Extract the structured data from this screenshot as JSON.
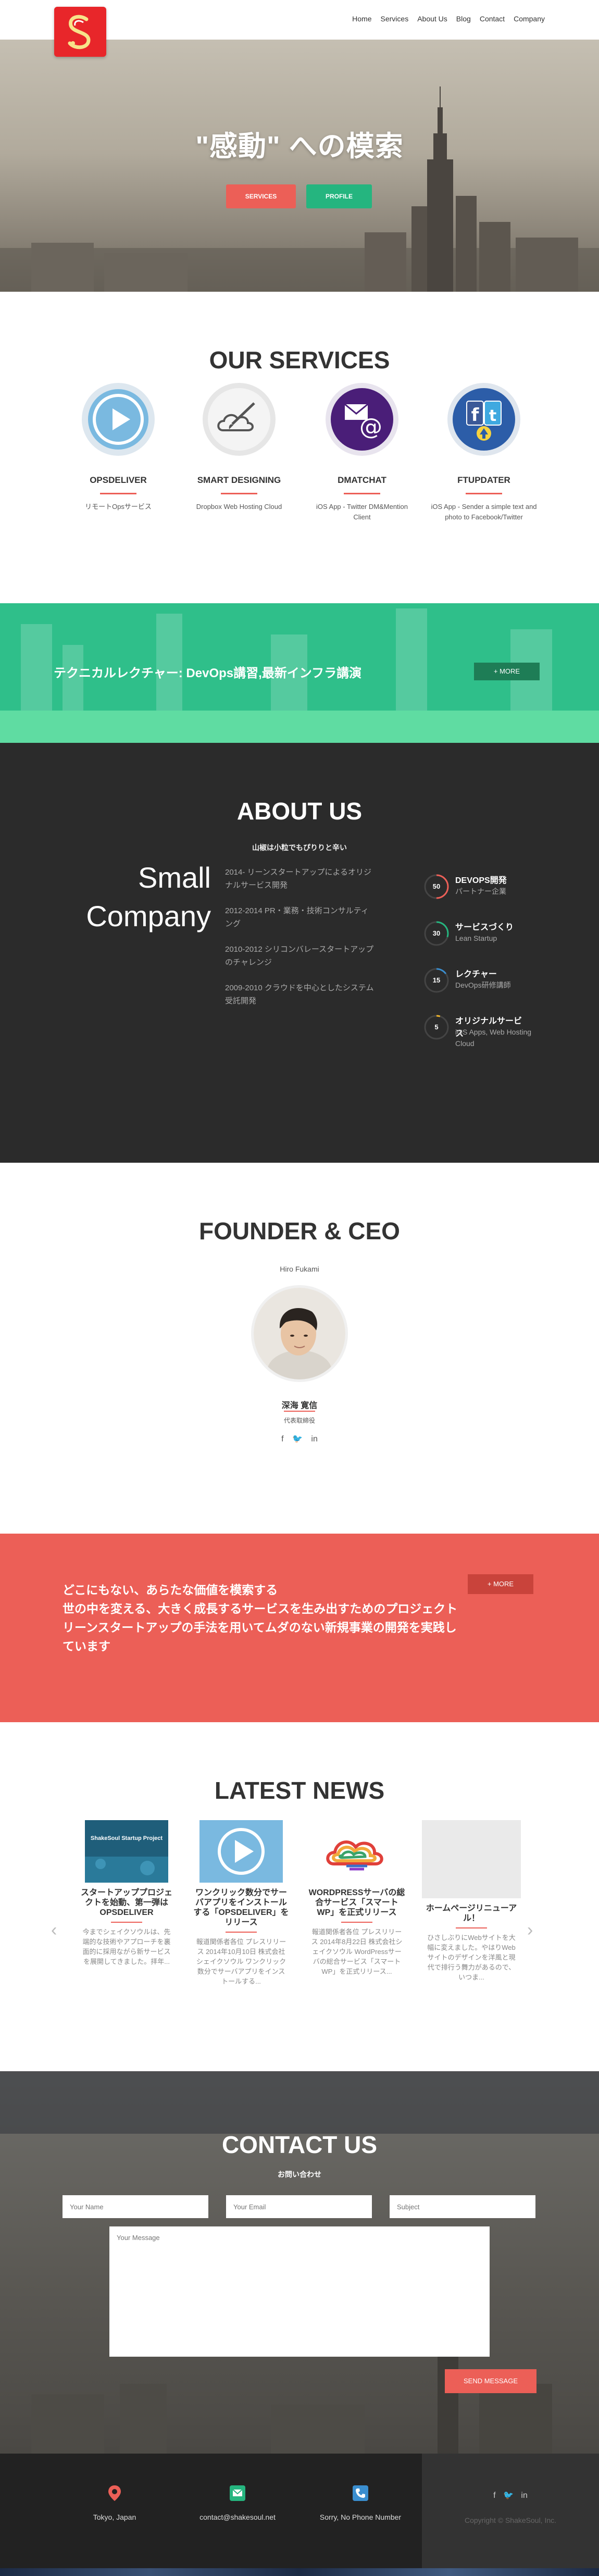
{
  "nav": {
    "menu": [
      "Home",
      "Services",
      "About Us",
      "Blog",
      "Contact",
      "Company"
    ]
  },
  "hero": {
    "title": "\"感動\" への模索",
    "services_btn": "SERVICES",
    "profile_btn": "PROFILE"
  },
  "services": {
    "title": "OUR SERVICES",
    "items": [
      {
        "name": "OPSDELIVER",
        "desc": "リモートOpsサービス",
        "icon": "play-icon"
      },
      {
        "name": "SMART DESIGNING",
        "desc": "Dropbox Web Hosting Cloud",
        "icon": "cloud-brush-icon"
      },
      {
        "name": "DMATCHAT",
        "desc": "iOS App - Twitter DM&Mention Client",
        "icon": "mail-at-icon"
      },
      {
        "name": "FTUPDATER",
        "desc": "iOS App - Sender a simple text and photo to Facebook/Twitter",
        "icon": "facebook-twitter-icon"
      }
    ]
  },
  "banner": {
    "text": "テクニカルレクチャー: DevOps講習,最新インフラ講演",
    "more": "+ MORE"
  },
  "about": {
    "title": "ABOUT US",
    "subtitle": "山椒は小粒でもぴりりと辛い",
    "big_line1": "Small",
    "big_line2": "Company",
    "timeline": [
      "2014- リーンスタートアップによるオリジナルサービス開発",
      "2012-2014 PR・業務・技術コンサルティング",
      "2010-2012 シリコンバレースタートアップのチャレンジ",
      "2009-2010 クラウドを中心としたシステム受託開発"
    ],
    "stats": [
      {
        "value": "50",
        "title": "DEVOPS開発",
        "desc": "パートナー企業",
        "fraction": 0.5,
        "color": "#ec5f57"
      },
      {
        "value": "30",
        "title": "サービスづくり",
        "desc": "Lean Startup",
        "fraction": 0.3,
        "color": "#25b57f"
      },
      {
        "value": "15",
        "title": "レクチャー",
        "desc": "DevOps研修講師",
        "fraction": 0.15,
        "color": "#3a8ecf"
      },
      {
        "value": "5",
        "title": "オリジナルサービス",
        "desc": "iOS Apps, Web Hosting Cloud",
        "fraction": 0.05,
        "color": "#f0b42a"
      }
    ]
  },
  "founder": {
    "title": "FOUNDER & CEO",
    "name_en": "Hiro Fukami",
    "name_jp": "深海 寛信",
    "role": "代表取締役",
    "socials": [
      "f",
      "🐦",
      "in"
    ]
  },
  "cta": {
    "line1": "どこにもない、あらたな価値を模索する",
    "line2": "世の中を変える、大きく成長するサービスを生み出すためのプロジェクト",
    "line3": "リーンスタートアップの手法を用いてムダのない新規事業の開発を実践しています",
    "more": "+ MORE"
  },
  "news": {
    "title": "LATEST NEWS",
    "items": [
      {
        "title": "スタートアッププロジェクトを始動、第一弾はOPSDELIVER",
        "body": "今までシェイクソウルは、先端的な技術やアプローチを裏面的に採用ながら新サービスを展開してきました。拝年..."
      },
      {
        "title": "ワンクリック数分でサーバアプリをインストールする「OPSDELIVER」をリリース",
        "body": "報道関係者各位 プレスリリース 2014年10月10日 株式会社シェイクソウル ワンクリック数分でサーバアプリをインストールする..."
      },
      {
        "title": "WORDPRESSサーバの総合サービス「スマートWP」を正式リリース",
        "body": "報道関係者各位 プレスリリース 2014年8月22日 株式会社シェイクソウル WordPressサーバの総合サービス「スマートWP」を正式リリース..."
      },
      {
        "title": "ホームページリニューアル！",
        "body": "ひさしぶりにWebサイトを大幅に変えました。やはりWebサイトのデザインを洋風と現代で排行う舞力があるので、いつま..."
      }
    ],
    "thumb_label": "ShakeSoul Startup Project"
  },
  "contact": {
    "title": "CONTACT US",
    "subtitle": "お問い合わせ",
    "name_placeholder": "Your Name",
    "email_placeholder": "Your Email",
    "subject_placeholder": "Subject",
    "message_placeholder": "Your Message",
    "send": "SEND MESSAGE"
  },
  "footer": {
    "location": "Tokyo, Japan",
    "email": "contact@shakesoul.net",
    "phone": "Sorry, No Phone Number",
    "socials": [
      "f",
      "🐦",
      "in"
    ],
    "copyright": "Copyright © ShakeSoul, Inc."
  }
}
